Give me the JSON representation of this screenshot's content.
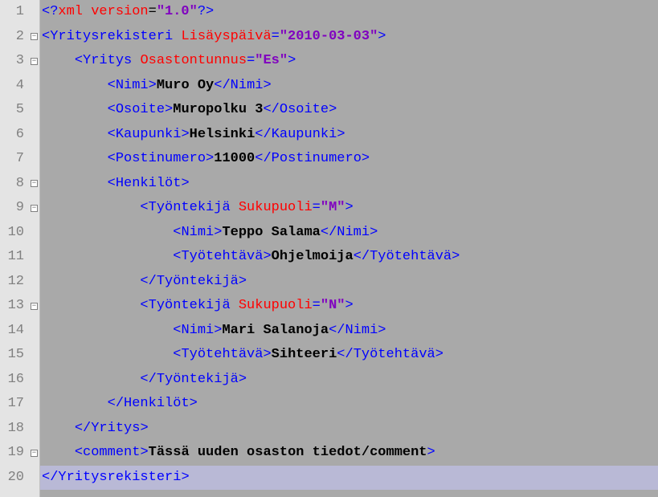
{
  "lines": [
    {
      "n": 1,
      "fold": "",
      "segs": [
        {
          "t": "<?",
          "c": "bracket"
        },
        {
          "t": "xml version",
          "c": "decl"
        },
        {
          "t": "=",
          "c": "declq"
        },
        {
          "t": "\"1.0\"",
          "c": "str"
        },
        {
          "t": "?>",
          "c": "bracket"
        }
      ]
    },
    {
      "n": 2,
      "fold": "-",
      "segs": [
        {
          "t": "<",
          "c": "bracket"
        },
        {
          "t": "Yritysrekisteri ",
          "c": "tag"
        },
        {
          "t": "Lisäyspäivä",
          "c": "attr"
        },
        {
          "t": "=",
          "c": "tag"
        },
        {
          "t": "\"2010-03-03\"",
          "c": "str"
        },
        {
          "t": ">",
          "c": "bracket"
        }
      ]
    },
    {
      "n": 3,
      "fold": "-",
      "indent": 1,
      "segs": [
        {
          "t": "<",
          "c": "bracket"
        },
        {
          "t": "Yritys ",
          "c": "tag"
        },
        {
          "t": "Osastontunnus",
          "c": "attr"
        },
        {
          "t": "=",
          "c": "tag"
        },
        {
          "t": "\"Es\"",
          "c": "str"
        },
        {
          "t": ">",
          "c": "bracket"
        }
      ]
    },
    {
      "n": 4,
      "fold": "",
      "indent": 2,
      "segs": [
        {
          "t": "<",
          "c": "bracket"
        },
        {
          "t": "Nimi",
          "c": "tag"
        },
        {
          "t": ">",
          "c": "bracket"
        },
        {
          "t": "Muro Oy",
          "c": "txt"
        },
        {
          "t": "</",
          "c": "bracket"
        },
        {
          "t": "Nimi",
          "c": "tag"
        },
        {
          "t": ">",
          "c": "bracket"
        }
      ]
    },
    {
      "n": 5,
      "fold": "",
      "indent": 2,
      "segs": [
        {
          "t": "<",
          "c": "bracket"
        },
        {
          "t": "Osoite",
          "c": "tag"
        },
        {
          "t": ">",
          "c": "bracket"
        },
        {
          "t": "Muropolku 3",
          "c": "txt"
        },
        {
          "t": "</",
          "c": "bracket"
        },
        {
          "t": "Osoite",
          "c": "tag"
        },
        {
          "t": ">",
          "c": "bracket"
        }
      ]
    },
    {
      "n": 6,
      "fold": "",
      "indent": 2,
      "segs": [
        {
          "t": "<",
          "c": "bracket"
        },
        {
          "t": "Kaupunki",
          "c": "tag"
        },
        {
          "t": ">",
          "c": "bracket"
        },
        {
          "t": "Helsinki",
          "c": "txt"
        },
        {
          "t": "</",
          "c": "bracket"
        },
        {
          "t": "Kaupunki",
          "c": "tag"
        },
        {
          "t": ">",
          "c": "bracket"
        }
      ]
    },
    {
      "n": 7,
      "fold": "",
      "indent": 2,
      "segs": [
        {
          "t": "<",
          "c": "bracket"
        },
        {
          "t": "Postinumero",
          "c": "tag"
        },
        {
          "t": ">",
          "c": "bracket"
        },
        {
          "t": "11000",
          "c": "txt"
        },
        {
          "t": "</",
          "c": "bracket"
        },
        {
          "t": "Postinumero",
          "c": "tag"
        },
        {
          "t": ">",
          "c": "bracket"
        }
      ]
    },
    {
      "n": 8,
      "fold": "-",
      "indent": 2,
      "segs": [
        {
          "t": "<",
          "c": "bracket"
        },
        {
          "t": "Henkilöt",
          "c": "tag"
        },
        {
          "t": ">",
          "c": "bracket"
        }
      ]
    },
    {
      "n": 9,
      "fold": "-",
      "indent": 3,
      "segs": [
        {
          "t": "<",
          "c": "bracket"
        },
        {
          "t": "Työntekijä ",
          "c": "tag"
        },
        {
          "t": "Sukupuoli",
          "c": "attr"
        },
        {
          "t": "=",
          "c": "tag"
        },
        {
          "t": "\"M\"",
          "c": "str"
        },
        {
          "t": ">",
          "c": "bracket"
        }
      ]
    },
    {
      "n": 10,
      "fold": "",
      "indent": 4,
      "segs": [
        {
          "t": "<",
          "c": "bracket"
        },
        {
          "t": "Nimi",
          "c": "tag"
        },
        {
          "t": ">",
          "c": "bracket"
        },
        {
          "t": "Teppo Salama",
          "c": "txt"
        },
        {
          "t": "</",
          "c": "bracket"
        },
        {
          "t": "Nimi",
          "c": "tag"
        },
        {
          "t": ">",
          "c": "bracket"
        }
      ]
    },
    {
      "n": 11,
      "fold": "",
      "indent": 4,
      "segs": [
        {
          "t": "<",
          "c": "bracket"
        },
        {
          "t": "Työtehtävä",
          "c": "tag"
        },
        {
          "t": ">",
          "c": "bracket"
        },
        {
          "t": "Ohjelmoija",
          "c": "txt"
        },
        {
          "t": "</",
          "c": "bracket"
        },
        {
          "t": "Työtehtävä",
          "c": "tag"
        },
        {
          "t": ">",
          "c": "bracket"
        }
      ]
    },
    {
      "n": 12,
      "fold": "",
      "indent": 3,
      "segs": [
        {
          "t": "</",
          "c": "bracket"
        },
        {
          "t": "Työntekijä",
          "c": "tag"
        },
        {
          "t": ">",
          "c": "bracket"
        }
      ]
    },
    {
      "n": 13,
      "fold": "-",
      "indent": 3,
      "segs": [
        {
          "t": "<",
          "c": "bracket"
        },
        {
          "t": "Työntekijä ",
          "c": "tag"
        },
        {
          "t": "Sukupuoli",
          "c": "attr"
        },
        {
          "t": "=",
          "c": "tag"
        },
        {
          "t": "\"N\"",
          "c": "str"
        },
        {
          "t": ">",
          "c": "bracket"
        }
      ]
    },
    {
      "n": 14,
      "fold": "",
      "indent": 4,
      "segs": [
        {
          "t": "<",
          "c": "bracket"
        },
        {
          "t": "Nimi",
          "c": "tag"
        },
        {
          "t": ">",
          "c": "bracket"
        },
        {
          "t": "Mari Salanoja",
          "c": "txt"
        },
        {
          "t": "</",
          "c": "bracket"
        },
        {
          "t": "Nimi",
          "c": "tag"
        },
        {
          "t": ">",
          "c": "bracket"
        }
      ]
    },
    {
      "n": 15,
      "fold": "",
      "indent": 4,
      "segs": [
        {
          "t": "<",
          "c": "bracket"
        },
        {
          "t": "Työtehtävä",
          "c": "tag"
        },
        {
          "t": ">",
          "c": "bracket"
        },
        {
          "t": "Sihteeri",
          "c": "txt"
        },
        {
          "t": "</",
          "c": "bracket"
        },
        {
          "t": "Työtehtävä",
          "c": "tag"
        },
        {
          "t": ">",
          "c": "bracket"
        }
      ]
    },
    {
      "n": 16,
      "fold": "",
      "indent": 3,
      "segs": [
        {
          "t": "</",
          "c": "bracket"
        },
        {
          "t": "Työntekijä",
          "c": "tag"
        },
        {
          "t": ">",
          "c": "bracket"
        }
      ]
    },
    {
      "n": 17,
      "fold": "",
      "indent": 2,
      "segs": [
        {
          "t": "</",
          "c": "bracket"
        },
        {
          "t": "Henkilöt",
          "c": "tag"
        },
        {
          "t": ">",
          "c": "bracket"
        }
      ]
    },
    {
      "n": 18,
      "fold": "",
      "indent": 1,
      "segs": [
        {
          "t": "</",
          "c": "bracket"
        },
        {
          "t": "Yritys",
          "c": "tag"
        },
        {
          "t": ">",
          "c": "bracket"
        }
      ]
    },
    {
      "n": 19,
      "fold": "-",
      "indent": 1,
      "segs": [
        {
          "t": "<",
          "c": "bracket"
        },
        {
          "t": "comment",
          "c": "tag"
        },
        {
          "t": ">",
          "c": "bracket"
        },
        {
          "t": "Tässä uuden osaston tiedot/comment",
          "c": "txt"
        },
        {
          "t": ">",
          "c": "bracket"
        }
      ]
    },
    {
      "n": 20,
      "fold": "",
      "hl": true,
      "segs": [
        {
          "t": "</",
          "c": "bracket"
        },
        {
          "t": "Yritysrekisteri",
          "c": "tag"
        },
        {
          "t": ">",
          "c": "bracket"
        }
      ]
    }
  ],
  "indentStr": "    "
}
